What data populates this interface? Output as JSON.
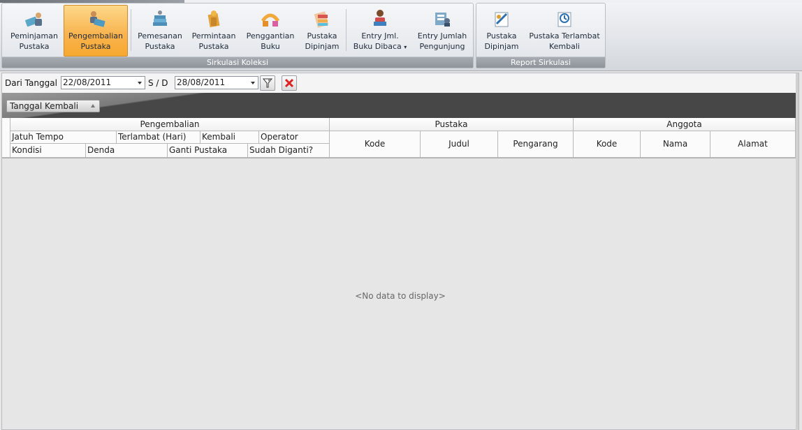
{
  "ribbon": {
    "groups": [
      {
        "label": "Sirkulasi Koleksi",
        "buttons": [
          {
            "line1": "Peminjaman",
            "line2": "Pustaka",
            "icon": "book-person-icon"
          },
          {
            "line1": "Pengembalian",
            "line2": "Pustaka",
            "icon": "book-return-icon",
            "active": true
          },
          {
            "line1": "Pemesanan",
            "line2": "Pustaka",
            "icon": "book-stack-icon"
          },
          {
            "line1": "Permintaan",
            "line2": "Pustaka",
            "icon": "book-request-icon"
          },
          {
            "line1": "Penggantian",
            "line2": "Buku",
            "icon": "book-replace-icon"
          },
          {
            "line1": "Pustaka",
            "line2": "Dipinjam",
            "icon": "borrowed-books-icon"
          },
          {
            "line1": "Entry Jml.",
            "line2": "Buku Dibaca",
            "icon": "reader-icon",
            "dropdown": true
          },
          {
            "line1": "Entry Jumlah",
            "line2": "Pengunjung",
            "icon": "visitors-icon"
          }
        ]
      },
      {
        "label": "Report Sirkulasi",
        "buttons": [
          {
            "line1": "Pustaka",
            "line2": "Dipinjam",
            "icon": "report-borrowed-icon"
          },
          {
            "line1": "Pustaka Terlambat",
            "line2": "Kembali",
            "icon": "report-late-icon"
          }
        ]
      }
    ]
  },
  "filter": {
    "from_label": "Dari Tanggal",
    "from_value": "22/08/2011",
    "sd_label": "S / D",
    "to_value": "28/08/2011",
    "filter_icon": "filter-icon",
    "clear_icon": "clear-x-icon"
  },
  "group_panel": {
    "chip_label": "Tanggal Kembali"
  },
  "grid": {
    "bands": {
      "pengembalian": "Pengembalian",
      "pustaka": "Pustaka",
      "anggota": "Anggota"
    },
    "pengembalian_row1": [
      "Jatuh Tempo",
      "Terlambat (Hari)",
      "Kembali",
      "Operator"
    ],
    "pengembalian_row2": [
      "Kondisi",
      "Denda",
      "Ganti Pustaka",
      "Sudah Diganti?"
    ],
    "pustaka_cols": [
      "Kode",
      "Judul",
      "Pengarang"
    ],
    "anggota_cols": [
      "Kode",
      "Nama",
      "Alamat"
    ],
    "empty_text": "<No data to display>"
  },
  "colors": {
    "active_button": "#f8b24c",
    "group_band": "#474747"
  }
}
